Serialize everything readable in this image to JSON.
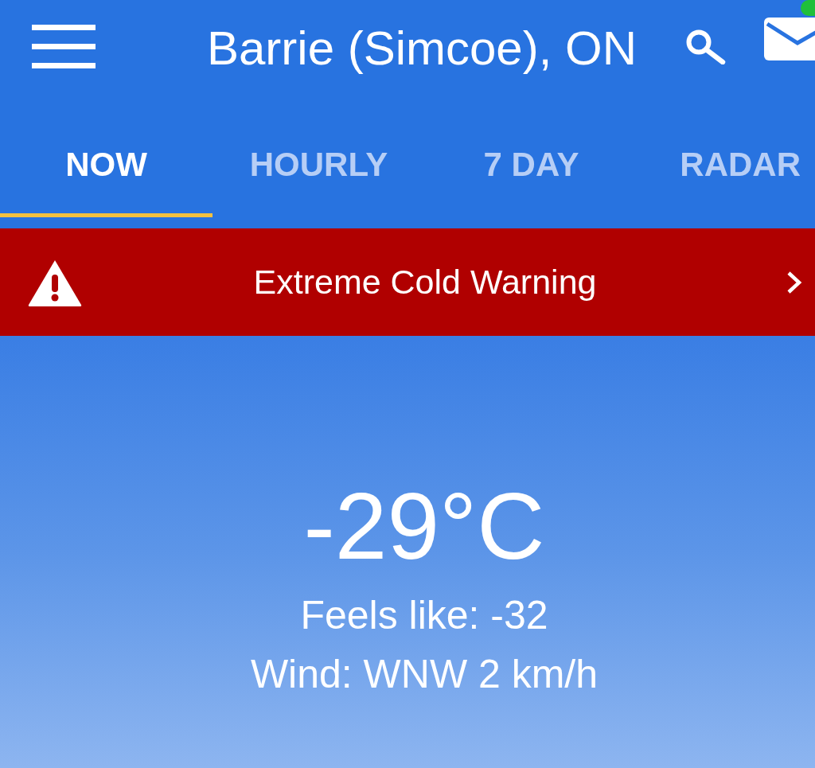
{
  "header": {
    "title": "Barrie (Simcoe), ON",
    "mail_unread": true
  },
  "tabs": [
    {
      "label": "NOW",
      "selected": true
    },
    {
      "label": "HOURLY",
      "selected": false
    },
    {
      "label": "7 DAY",
      "selected": false
    },
    {
      "label": "RADAR",
      "selected": false
    }
  ],
  "alert": {
    "title": "Extreme Cold Warning"
  },
  "current": {
    "temperature": "-29°C",
    "feels_like": "Feels like: -32",
    "wind": "Wind: WNW 2 km/h"
  }
}
